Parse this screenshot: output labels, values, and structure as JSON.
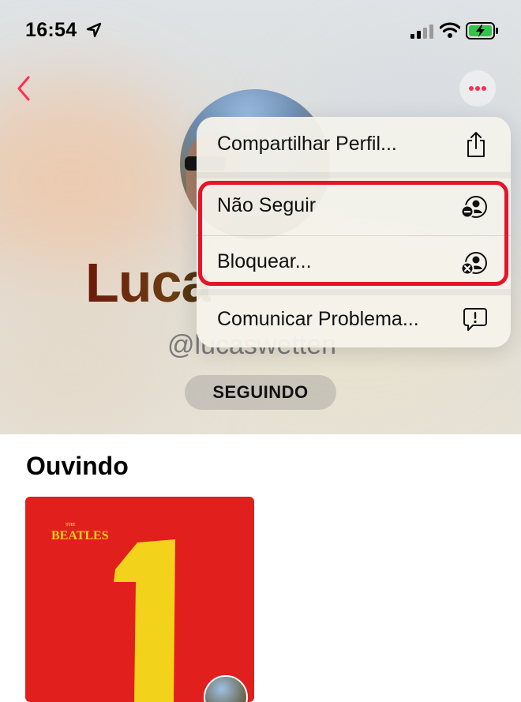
{
  "status_bar": {
    "time": "16:54",
    "icons": [
      "location-arrow-icon",
      "cellular-signal-icon",
      "wifi-icon",
      "battery-charging-icon"
    ]
  },
  "nav": {
    "back_icon": "chevron-left-icon",
    "more_icon": "ellipsis-icon",
    "accent_color": "#ff2d55"
  },
  "profile": {
    "name": "Luca",
    "handle": "@lucaswetten",
    "follow_button": "SEGUINDO"
  },
  "menu": {
    "items": [
      {
        "label": "Compartilhar Perfil...",
        "icon": "share-icon"
      },
      {
        "label": "Não Seguir",
        "icon": "unfollow-person-icon"
      },
      {
        "label": "Bloquear...",
        "icon": "block-person-icon"
      },
      {
        "label": "Comunicar Problema...",
        "icon": "report-bubble-icon"
      }
    ],
    "highlight_color": "#e5142b"
  },
  "listening": {
    "title": "Ouvindo",
    "album": {
      "band": "BEATLES",
      "band_prefix": "THE",
      "number": "1",
      "bg_color": "#e11f1d",
      "text_color": "#f3d21b"
    }
  }
}
